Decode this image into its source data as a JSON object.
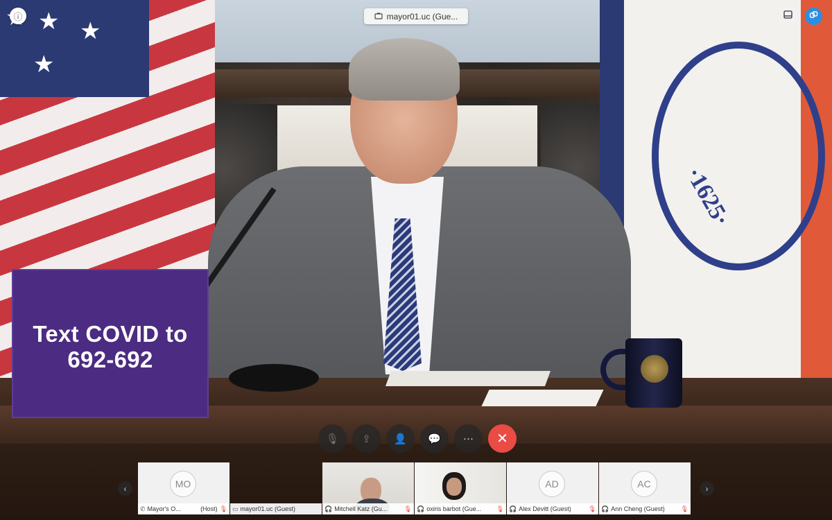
{
  "window": {
    "title": "mayor01.uc (Gue..."
  },
  "sign": {
    "line1": "Text COVID to",
    "line2": "692-692"
  },
  "seal": {
    "year": "·1625·"
  },
  "controls": [
    {
      "name": "mute-mic-button",
      "icon": "mic-off-icon",
      "glyph": "🎙"
    },
    {
      "name": "share-screen-button",
      "icon": "share-icon",
      "glyph": "⇪"
    },
    {
      "name": "participants-button",
      "icon": "participants-icon",
      "glyph": "👤"
    },
    {
      "name": "chat-button",
      "icon": "chat-icon",
      "glyph": "💬"
    },
    {
      "name": "more-button",
      "icon": "more-icon",
      "glyph": "···"
    },
    {
      "name": "end-call-button",
      "icon": "close-icon",
      "glyph": "✕"
    }
  ],
  "participants": [
    {
      "initials": "MO",
      "label": "Mayor's O...",
      "role": "(Host)",
      "icon": "phone-icon",
      "muted": true
    },
    {
      "initials": "",
      "label": "mayor01.uc (Guest)",
      "role": "",
      "icon": "room-icon",
      "muted": false
    },
    {
      "initials": "",
      "label": "Mitchell Katz (Gu...",
      "role": "",
      "icon": "headset-icon",
      "muted": true
    },
    {
      "initials": "",
      "label": "oxiris barbot (Gue...",
      "role": "",
      "icon": "headset-icon",
      "muted": true
    },
    {
      "initials": "AD",
      "label": "Alex Devitt (Guest)",
      "role": "",
      "icon": "headset-icon",
      "muted": true
    },
    {
      "initials": "AC",
      "label": "Ann Cheng (Guest)",
      "role": "",
      "icon": "headset-icon",
      "muted": true
    }
  ],
  "colors": {
    "end_call": "#ea4b45",
    "share_accent": "#2a8fe0",
    "sign_purple": "#4c2b82",
    "muted_red": "#e04a3a"
  }
}
